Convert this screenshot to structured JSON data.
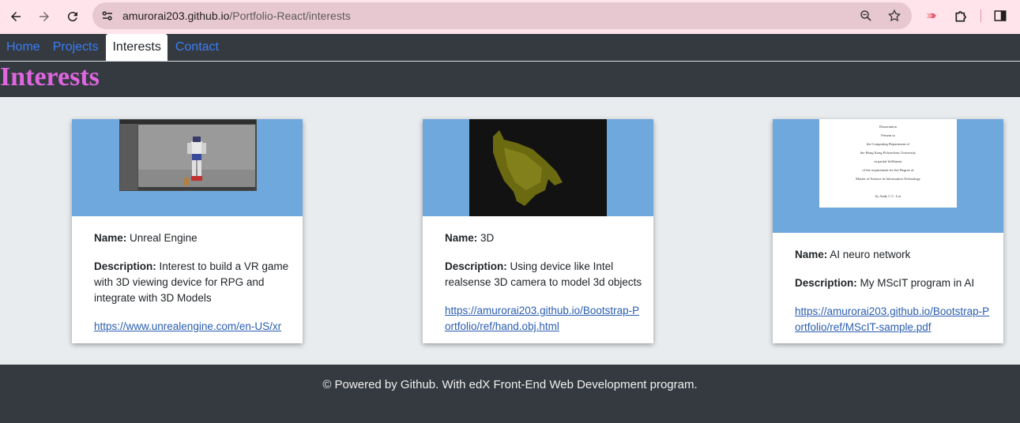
{
  "browser": {
    "url_host": "amurorai203.github.io",
    "url_path": "/Portfolio-React/interests"
  },
  "nav": {
    "tabs": [
      {
        "label": "Home"
      },
      {
        "label": "Projects"
      },
      {
        "label": "Interests"
      },
      {
        "label": "Contact"
      }
    ]
  },
  "page": {
    "title": "Interests"
  },
  "cards": [
    {
      "name_label": "Name:",
      "name": "Unreal Engine",
      "desc_label": "Description:",
      "description": "Interest to build a VR game with 3D viewing device for RPG and integrate with 3D Models",
      "link": "https://www.unrealengine.com/en-US/xr"
    },
    {
      "name_label": "Name:",
      "name": "3D",
      "desc_label": "Description:",
      "description": "Using device like Intel realsense 3D camera to model 3d objects",
      "link": "https://amurorai203.github.io/Bootstrap-Portfolio/ref/hand.obj.html"
    },
    {
      "name_label": "Name:",
      "name": "AI neuro network",
      "desc_label": "Description:",
      "description": "My MScIT program in AI",
      "link": "https://amurorai203.github.io/Bootstrap-Portfolio/ref/MScIT-sample.pdf",
      "doc_lines": [
        "Dissertation",
        "Present to",
        "the Computing Department of",
        "the Hong Kong Polytechnic University",
        "in partial fulfilment",
        "of the requirement for the Degree of",
        "Master of Science in Information Technology",
        "by Andy C.C. Lui"
      ]
    }
  ],
  "footer": {
    "text": "© Powered by Github. With edX Front-End Web Development program."
  },
  "colors": {
    "chrome_bg": "#ffe4ec",
    "nav_bg": "#343a40",
    "title_color": "#e066e0",
    "card_image_bg": "#6fa8dc",
    "link": "#2a5db0"
  }
}
